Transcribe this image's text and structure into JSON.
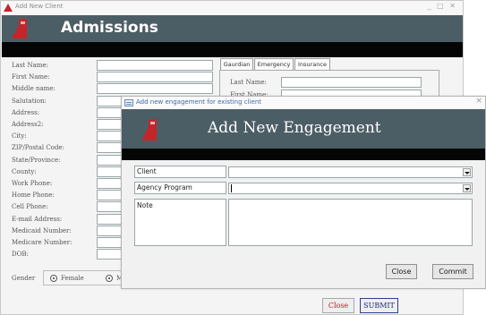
{
  "background_window": {
    "title": "Add New Client",
    "window_controls": "_ □ ✕",
    "header_title": "Admissions",
    "form_labels": [
      "Last Name:",
      "First Name:",
      "Middle name:",
      "Salutation:",
      "Address:",
      "Address2:",
      "City:",
      "ZIP/Postal Code:",
      "State/Province:",
      "County:",
      "Work Phone:",
      "Home Phone:",
      "Cell Phone:",
      "E-mail Address:",
      "Medicaid Number:",
      "Medicare Number:",
      "DOB:"
    ],
    "gender": {
      "label": "Gender",
      "options": [
        "Female",
        "M"
      ]
    },
    "tabs": [
      "Gaurdian",
      "Emergency",
      "Insurance"
    ],
    "tab_fields": [
      "Last Name:",
      "First Name:"
    ],
    "close_label": "Close",
    "submit_label": "SUBMIT",
    "colors": {
      "header": "#4c5e65",
      "close_text": "#c2191f",
      "submit_text": "#1e2d7a"
    }
  },
  "modal": {
    "title": "Add new engagement for existing client",
    "close_glyph": "×",
    "header_title": "Add New Engagement",
    "fields": {
      "client_label": "Client",
      "program_label": "Agency Program",
      "note_label": "Note"
    },
    "buttons": {
      "close": "Close",
      "commit": "Commit"
    },
    "icon_names": [
      "window-icon",
      "close-icon",
      "logo-icon",
      "dropdown-arrow-icon"
    ]
  }
}
